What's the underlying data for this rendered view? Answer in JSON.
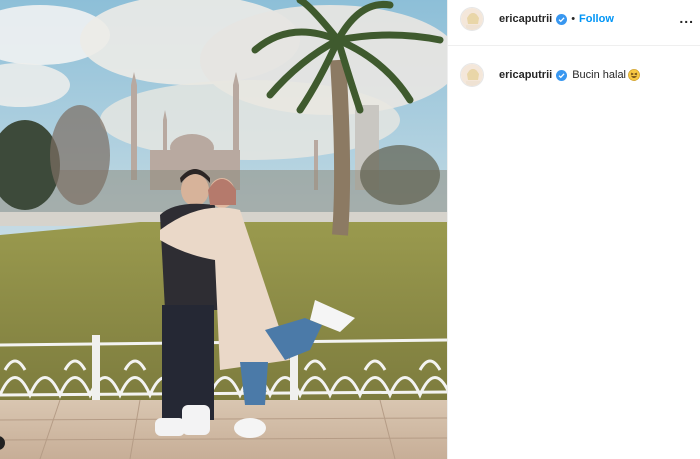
{
  "post": {
    "username": "ericaputrii",
    "follow_label": "Follow",
    "separator": "•",
    "more_label": "...",
    "caption": "Bucin halal",
    "caption_emoji": "grinning-squinting-face",
    "verified_icon": "verified-badge-icon"
  },
  "colors": {
    "follow_blue": "#0095f6",
    "verified_blue": "#3897f0",
    "text": "#262626"
  }
}
